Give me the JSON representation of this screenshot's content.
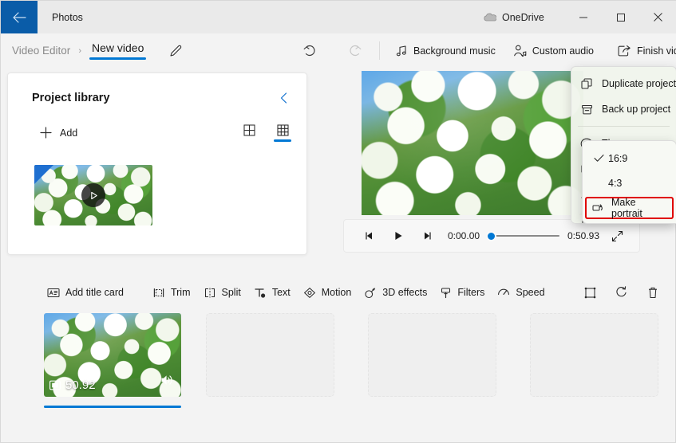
{
  "titlebar": {
    "app_name": "Photos",
    "back_icon": "back-arrow-icon",
    "onedrive_label": "OneDrive",
    "onedrive_icon": "cloud-icon",
    "minimize_label": "─",
    "maximize_label": "☐",
    "close_label": "✕",
    "back_button_color": "#0a5ca8"
  },
  "commandbar": {
    "breadcrumb_parent": "Video Editor",
    "breadcrumb_chevron": "›",
    "breadcrumb_current": "New video",
    "rename_icon": "pencil-icon",
    "undo_icon": "undo-icon",
    "redo_icon": "redo-icon",
    "items": [
      {
        "label": "Background music",
        "icon": "music-note-icon"
      },
      {
        "label": "Custom audio",
        "icon": "person-audio-icon"
      },
      {
        "label": "Finish video",
        "icon": "export-icon"
      }
    ],
    "overflow_label": "···",
    "accent_color": "#0078d4"
  },
  "library": {
    "title": "Project library",
    "collapse_icon": "chevron-left-icon",
    "add_label": "Add",
    "add_icon": "plus-icon",
    "view_large_icon": "grid-large-icon",
    "view_small_icon": "grid-small-icon",
    "active_view": "grid-small",
    "thumbnail_alt": "white snowball flowers video thumbnail",
    "play_icon": "play-icon"
  },
  "preview": {
    "image_alt": "white snowball viburnum flowers with green leaves and blue sky"
  },
  "player": {
    "prev_frame_icon": "previous-frame-icon",
    "play_icon": "play-icon",
    "next_frame_icon": "next-frame-icon",
    "current_time": "0:00.00",
    "total_time": "0:50.93",
    "scrub_position_percent": 0,
    "expand_icon": "fullscreen-icon"
  },
  "edit_toolbar": {
    "items": [
      {
        "label": "Add title card",
        "icon": "title-card-icon"
      },
      {
        "label": "Trim",
        "icon": "trim-icon"
      },
      {
        "label": "Split",
        "icon": "split-icon"
      },
      {
        "label": "Text",
        "icon": "text-icon"
      },
      {
        "label": "Motion",
        "icon": "motion-icon"
      },
      {
        "label": "3D effects",
        "icon": "3d-effects-icon"
      },
      {
        "label": "Filters",
        "icon": "filters-icon"
      },
      {
        "label": "Speed",
        "icon": "speed-icon"
      }
    ],
    "icon_only": [
      {
        "name": "crop-icon"
      },
      {
        "name": "rotate-icon"
      },
      {
        "name": "delete-icon"
      }
    ],
    "overflow_label": "···"
  },
  "storyboard": {
    "clip": {
      "duration": "50.92",
      "film_icon": "film-strip-icon",
      "audio_icon": "speaker-icon",
      "selected": true
    },
    "empty_slot_count": 3,
    "selection_color": "#0078d4"
  },
  "menu": {
    "items": [
      {
        "label": "Duplicate project",
        "icon": "duplicate-icon"
      },
      {
        "label": "Back up project",
        "icon": "backup-icon"
      },
      {
        "label": "Themes",
        "icon": "themes-palette-icon"
      }
    ]
  },
  "submenu": {
    "options": [
      {
        "label": "16:9",
        "checked": true
      },
      {
        "label": "4:3",
        "checked": false
      }
    ],
    "action": {
      "label": "Make portrait",
      "icon": "make-portrait-icon"
    },
    "highlight_color": "#e00000",
    "check_icon": "checkmark-icon"
  }
}
